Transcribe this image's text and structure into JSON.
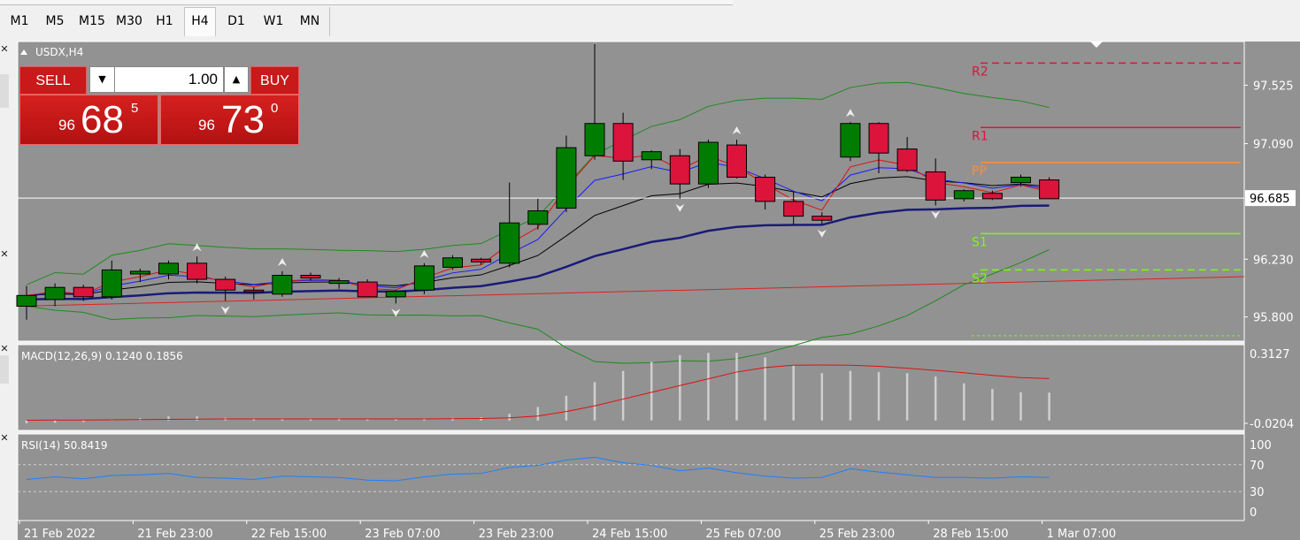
{
  "timeframes": [
    {
      "label": "M1",
      "active": false
    },
    {
      "label": "M5",
      "active": false
    },
    {
      "label": "M15",
      "active": false
    },
    {
      "label": "M30",
      "active": false
    },
    {
      "label": "H1",
      "active": false
    },
    {
      "label": "H4",
      "active": true
    },
    {
      "label": "D1",
      "active": false
    },
    {
      "label": "W1",
      "active": false
    },
    {
      "label": "MN",
      "active": false
    }
  ],
  "symbol_label": "USDX,H4",
  "trade": {
    "sell_label": "SELL",
    "buy_label": "BUY",
    "volume": "1.00",
    "sell_price": {
      "prefix": "96",
      "main": "68",
      "sup": "5"
    },
    "buy_price": {
      "prefix": "96",
      "main": "73",
      "sup": "0"
    }
  },
  "chart_data": {
    "type": "candlestick",
    "price_range": [
      95.62,
      97.85
    ],
    "price_ticks": [
      "97.525",
      "97.090",
      "96.230",
      "95.800"
    ],
    "current_price": "96.685",
    "pivot_labels": [
      "R2",
      "R1",
      "PP",
      "S1",
      "S2"
    ],
    "candles": [
      [
        95.88,
        96.03,
        95.78,
        95.96
      ],
      [
        95.93,
        96.05,
        95.88,
        96.02
      ],
      [
        96.02,
        96.04,
        95.92,
        95.95
      ],
      [
        95.95,
        96.22,
        95.93,
        96.15
      ],
      [
        96.12,
        96.16,
        96.06,
        96.14
      ],
      [
        96.12,
        96.22,
        96.08,
        96.2
      ],
      [
        96.2,
        96.25,
        96.05,
        96.08
      ],
      [
        96.08,
        96.1,
        95.92,
        96.0
      ],
      [
        96.0,
        96.02,
        95.93,
        95.99
      ],
      [
        95.97,
        96.14,
        95.95,
        96.11
      ],
      [
        96.11,
        96.13,
        96.07,
        96.09
      ],
      [
        96.05,
        96.09,
        96.01,
        96.07
      ],
      [
        96.06,
        96.08,
        95.95,
        95.95
      ],
      [
        95.95,
        96.0,
        95.9,
        95.99
      ],
      [
        96.0,
        96.2,
        95.97,
        96.18
      ],
      [
        96.17,
        96.26,
        96.15,
        96.24
      ],
      [
        96.23,
        96.24,
        96.19,
        96.21
      ],
      [
        96.2,
        96.8,
        96.17,
        96.5
      ],
      [
        96.49,
        96.68,
        96.45,
        96.59
      ],
      [
        96.61,
        97.15,
        96.58,
        97.06
      ],
      [
        97.0,
        97.83,
        96.97,
        97.24
      ],
      [
        97.24,
        97.32,
        96.82,
        96.96
      ],
      [
        96.97,
        97.04,
        96.9,
        97.03
      ],
      [
        97.0,
        97.05,
        96.68,
        96.79
      ],
      [
        96.79,
        97.12,
        96.76,
        97.1
      ],
      [
        97.08,
        97.12,
        96.83,
        96.84
      ],
      [
        96.84,
        96.86,
        96.6,
        96.66
      ],
      [
        96.66,
        96.73,
        96.49,
        96.55
      ],
      [
        96.55,
        96.58,
        96.49,
        96.52
      ],
      [
        96.99,
        97.25,
        96.96,
        97.24
      ],
      [
        97.24,
        97.25,
        96.87,
        97.02
      ],
      [
        97.05,
        97.14,
        96.88,
        96.89
      ],
      [
        96.88,
        96.98,
        96.63,
        96.67
      ],
      [
        96.68,
        96.75,
        96.66,
        96.74
      ],
      [
        96.72,
        96.74,
        96.67,
        96.68
      ],
      [
        96.8,
        96.86,
        96.77,
        96.84
      ],
      [
        96.82,
        96.84,
        96.68,
        96.68
      ]
    ],
    "macd": {
      "label": "MACD(12,26,9) 0.1240 0.1856",
      "range": [
        -0.0204,
        0.3127
      ],
      "ticks": [
        "0.3127",
        "-0.0204"
      ],
      "hist": [
        -0.012,
        -0.01,
        -0.006,
        0.004,
        0.01,
        0.018,
        0.018,
        0.012,
        0.01,
        0.01,
        0.01,
        0.01,
        0.008,
        0.006,
        0.01,
        0.012,
        0.014,
        0.03,
        0.06,
        0.11,
        0.17,
        0.22,
        0.26,
        0.29,
        0.3,
        0.3,
        0.28,
        0.245,
        0.21,
        0.22,
        0.215,
        0.21,
        0.195,
        0.165,
        0.14,
        0.125,
        0.124
      ],
      "signal": [
        0.001,
        0.002,
        0.002,
        0.003,
        0.004,
        0.005,
        0.006,
        0.007,
        0.007,
        0.007,
        0.007,
        0.007,
        0.007,
        0.007,
        0.007,
        0.008,
        0.009,
        0.012,
        0.02,
        0.04,
        0.065,
        0.095,
        0.125,
        0.155,
        0.185,
        0.215,
        0.235,
        0.245,
        0.246,
        0.245,
        0.24,
        0.232,
        0.222,
        0.212,
        0.2,
        0.19,
        0.186
      ]
    },
    "rsi": {
      "label": "RSI(14) 50.8419",
      "ticks": [
        "100",
        "70",
        "30",
        "0"
      ],
      "levels": [
        100,
        70,
        30,
        0
      ],
      "values": [
        48,
        52,
        49,
        54,
        55,
        57,
        51,
        50,
        48,
        53,
        52,
        51,
        47,
        46,
        52,
        56,
        57,
        66,
        69,
        77,
        81,
        73,
        69,
        61,
        65,
        58,
        53,
        50,
        51,
        64,
        59,
        55,
        51,
        51,
        50,
        52,
        51
      ]
    },
    "x_labels": [
      "21 Feb 2022",
      "21 Feb 23:00",
      "22 Feb 15:00",
      "23 Feb 07:00",
      "23 Feb 23:00",
      "24 Feb 15:00",
      "25 Feb 07:00",
      "25 Feb 23:00",
      "28 Feb 15:00",
      "1 Mar 07:00"
    ]
  },
  "colors": {
    "bull": "#007d00",
    "bear": "#dc143c",
    "chart_bg": "#929292",
    "panel_border": "#ffffff"
  }
}
